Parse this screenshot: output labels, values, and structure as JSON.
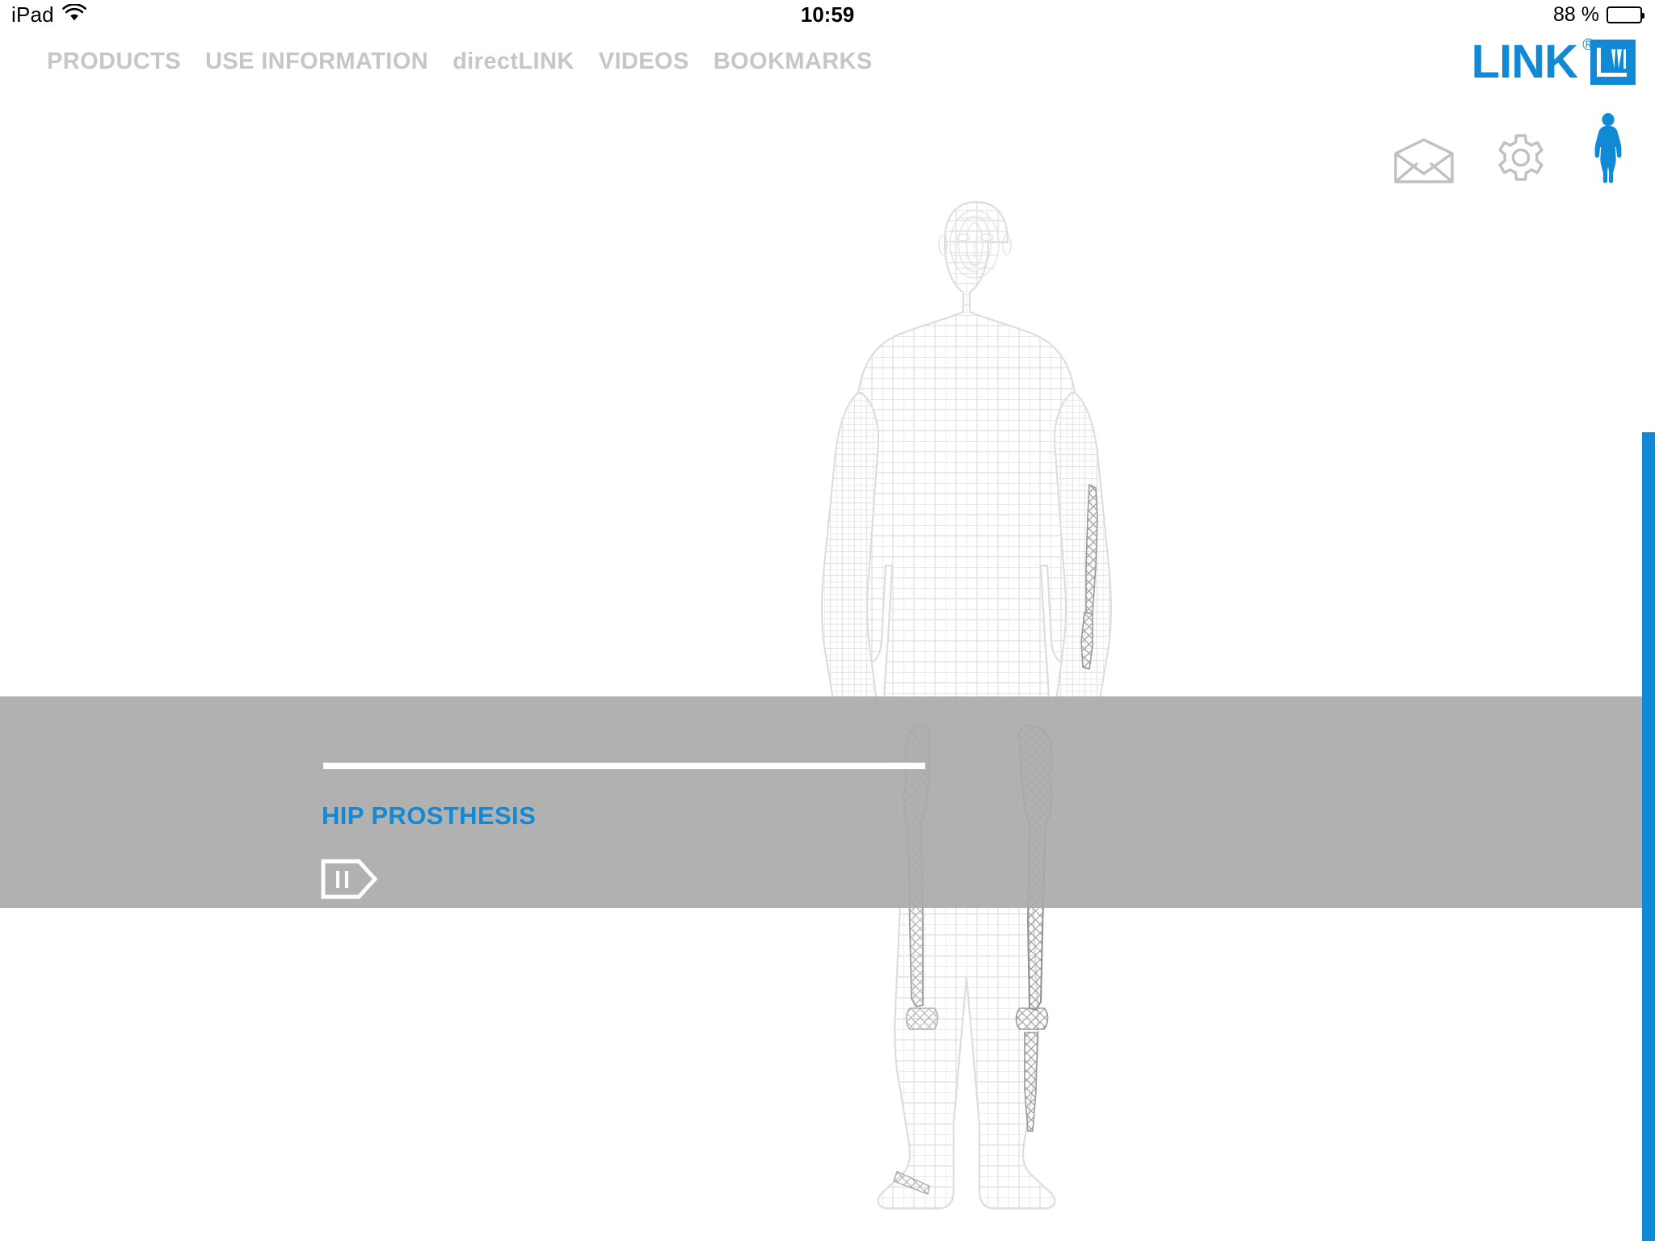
{
  "status_bar": {
    "device_label": "iPad",
    "wifi_icon": "wifi-icon",
    "time": "10:59",
    "battery_percent": "88 %",
    "battery_icon": "battery-full-icon"
  },
  "top_nav": {
    "items": [
      {
        "label": "PRODUCTS",
        "name": "nav-products"
      },
      {
        "label": "USE INFORMATION",
        "name": "nav-use-information"
      },
      {
        "label": "directLINK",
        "name": "nav-directlink"
      },
      {
        "label": "VIDEOS",
        "name": "nav-videos"
      },
      {
        "label": "BOOKMARKS",
        "name": "nav-bookmarks"
      }
    ],
    "text_color": "#c6c6c6"
  },
  "brand": {
    "wordmark": "LINK",
    "registered_mark": "®",
    "logo_mark": "link-w-square-logo",
    "color": "#1189d4"
  },
  "utility_icons": [
    {
      "name": "mail-icon",
      "label": "Mail",
      "color": "#bcbcbc"
    },
    {
      "name": "settings-gear-icon",
      "label": "Settings",
      "color": "#bcbcbc"
    },
    {
      "name": "human-body-icon",
      "label": "Body",
      "color": "#1189d4"
    }
  ],
  "main": {
    "anatomy_model": "human-body-wireframe",
    "anatomy_model_color": "#e6e6e6",
    "implants_visible": [
      "hip-prosthesis-left",
      "hip-prosthesis-right",
      "shoulder-implant",
      "elbow-implant",
      "knee-implant",
      "ankle-implant"
    ]
  },
  "info_band": {
    "title": "HIP PROSTHESIS",
    "title_color": "#1189d4",
    "band_color": "#aaaaaa",
    "callout_line_color": "#ffffff",
    "pause_button": {
      "name": "pause-tag-button",
      "icon": "pause-icon",
      "shape": "pentagon-tag"
    }
  },
  "scrollbar": {
    "name": "vertical-scrollbar",
    "thumb_color": "#1189d4",
    "position": "right"
  }
}
